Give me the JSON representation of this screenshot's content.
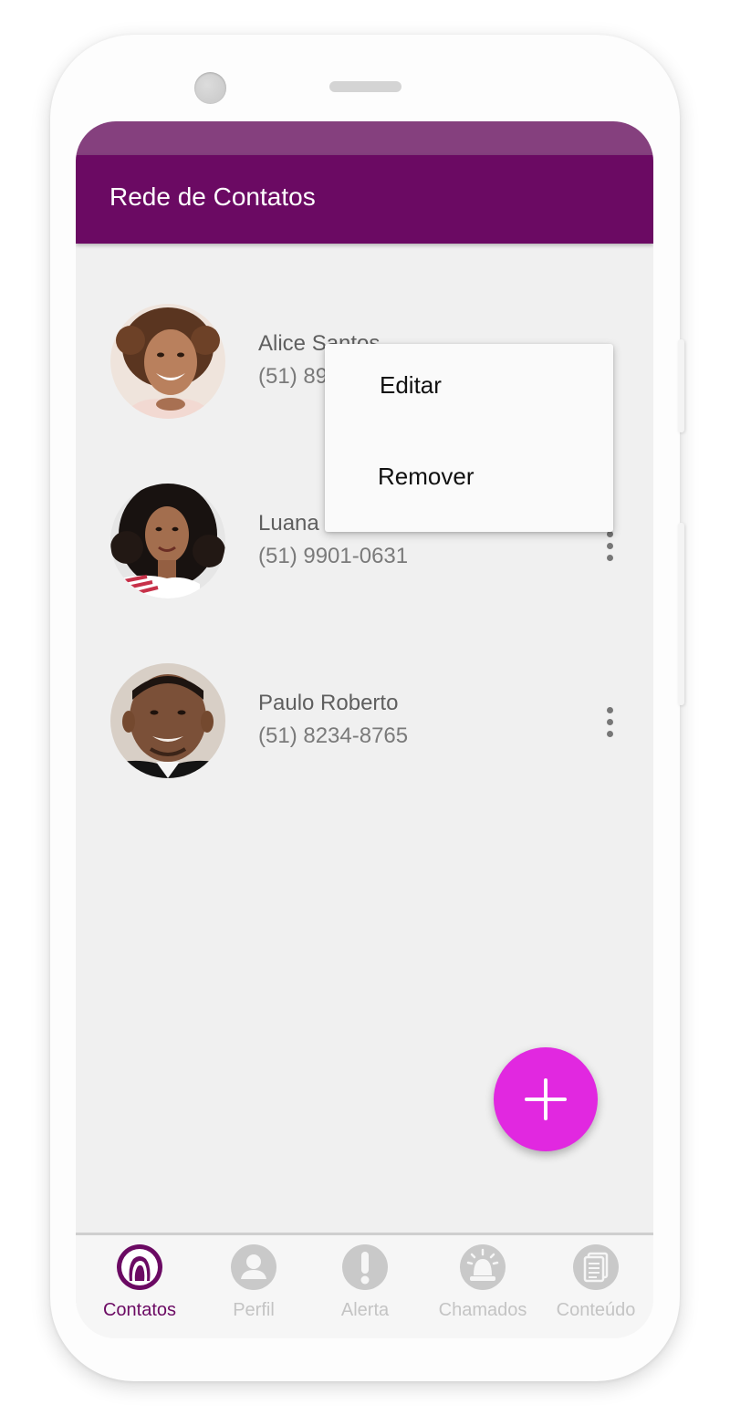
{
  "app": {
    "title": "Rede de Contatos"
  },
  "contacts": [
    {
      "name": "Alice Santos",
      "phone": "(51) 89",
      "avatar": "woman-curly-hair-photo"
    },
    {
      "name": "Luana",
      "phone": "(51) 9901-0631",
      "avatar": "woman-dark-curly-hair-photo"
    },
    {
      "name": "Paulo Roberto",
      "phone": "(51) 8234-8765",
      "avatar": "man-smiling-photo"
    }
  ],
  "context_menu": {
    "items": [
      "Editar",
      "Remover"
    ]
  },
  "fab": {
    "icon": "plus-icon"
  },
  "bottom_nav": {
    "items": [
      {
        "label": "Contatos",
        "icon": "contacts-icon",
        "active": true
      },
      {
        "label": "Perfil",
        "icon": "profile-icon",
        "active": false
      },
      {
        "label": "Alerta",
        "icon": "alert-icon",
        "active": false
      },
      {
        "label": "Chamados",
        "icon": "siren-icon",
        "active": false
      },
      {
        "label": "Conteúdo",
        "icon": "document-icon",
        "active": false
      }
    ]
  },
  "colors": {
    "primary": "#6b0a63",
    "statusbar": "#85407e",
    "accent": "#e128e0",
    "background": "#f0f0f0",
    "inactive": "#c4c4c4"
  }
}
